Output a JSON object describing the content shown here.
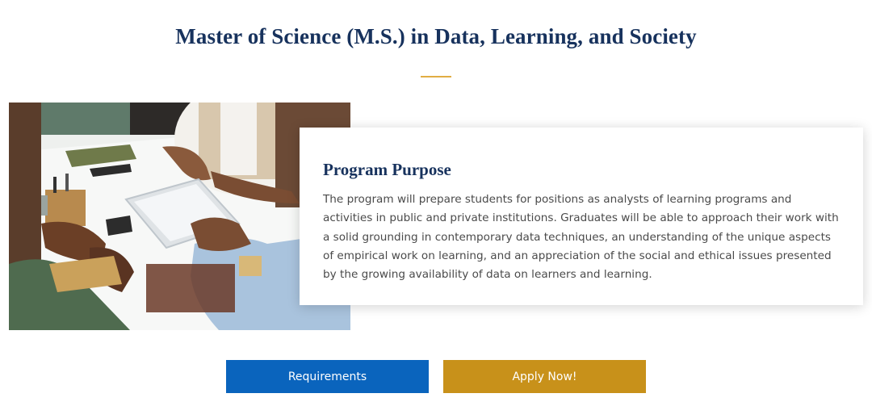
{
  "header": {
    "title": "Master of Science (M.S.) in Data, Learning, and Society"
  },
  "program": {
    "heading": "Program Purpose",
    "body": "The program will prepare students for positions as analysts of learning programs and activities in public and private institutions. Graduates will be able to approach their work with a solid grounding in contemporary data techniques, an understanding of the unique aspects of empirical work on learning, and an appreciation of the social and ethical issues presented by the growing availability of data on learners and learning."
  },
  "actions": {
    "requirements_label": "Requirements",
    "apply_label": "Apply Now!"
  },
  "colors": {
    "title": "#17325d",
    "accent_divider": "#e1ad43",
    "requirements_button": "#0a64bd",
    "apply_button": "#c8911a"
  }
}
